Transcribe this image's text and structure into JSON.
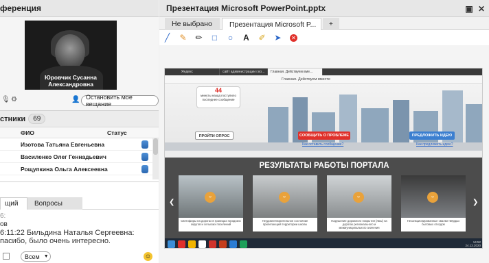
{
  "left": {
    "video_title": "ференция",
    "video_caption": "Юровчик Сусанна Александровна",
    "stop_button": "Остановить мое вещание",
    "participants_title": "стники",
    "participants_count": "69",
    "columns": {
      "name": "ФИО",
      "status": "Статус"
    },
    "participants": [
      {
        "name": "Изотова Татьяна  Евгеньевна"
      },
      {
        "name": "Василенко Олег  Геннадьевич"
      },
      {
        "name": "Рощупкина Ольга  Алексеевна"
      }
    ],
    "chat_tabs": [
      "щий",
      "Вопросы"
    ],
    "chat_lines": [
      "6:",
      "ов",
      "6:11:22  Бильдина Наталья  Сергеевна:",
      "пасибо, было очень интересно."
    ],
    "recipient_select": "Всем",
    "emoji": "☺"
  },
  "right": {
    "title": "Презентация Microsoft PowerPoint.pptx",
    "tabs": [
      "Не выбрано",
      "Презентация Microsoft P...",
      "+"
    ],
    "tools": [
      "line-tool-icon",
      "marker-tool-icon",
      "pen-tool-icon",
      "rectangle-tool-icon",
      "ellipse-tool-icon",
      "text-tool-icon",
      "highlighter-tool-icon",
      "pointer-tool-icon",
      "clear-tool-icon"
    ],
    "browser": {
      "tabs": [
        "Яндекс",
        "сайт администрации г.ко...",
        "Главная. Действуем вме..."
      ],
      "address": "Главная. Действуем вместе",
      "bubble_number": "44",
      "bubble_text": "минуты назад поступило последнее сообщение",
      "btn_survey": "ПРОЙТИ ОПРОС",
      "btn_report": "СООБЩИТЬ О ПРОБЛЕМЕ",
      "btn_idea": "ПРЕДЛОЖИТЬ ИДЕЮ",
      "link_report": "Как оставить сообщение?",
      "link_idea": "Как предложить идею?",
      "results_title": "РЕЗУЛЬТАТЫ РАБОТЫ ПОРТАЛА",
      "cards": [
        "Светофоры на дорогах в границах городских округов и сельских поселений",
        "Неудовлетворительное состояние прилегающей территории школы",
        "Нарушение дорожного покрытия (ямы) на дорогах регионального и межмуниципального значения",
        "Несанкционированные свалки твёрдых бытовых отходов"
      ],
      "clock": "14:52",
      "date": "24.12.2020"
    }
  },
  "colors": {
    "accent": "#e0302a",
    "link": "#2a66c8",
    "panel": "#e7e7e7"
  }
}
